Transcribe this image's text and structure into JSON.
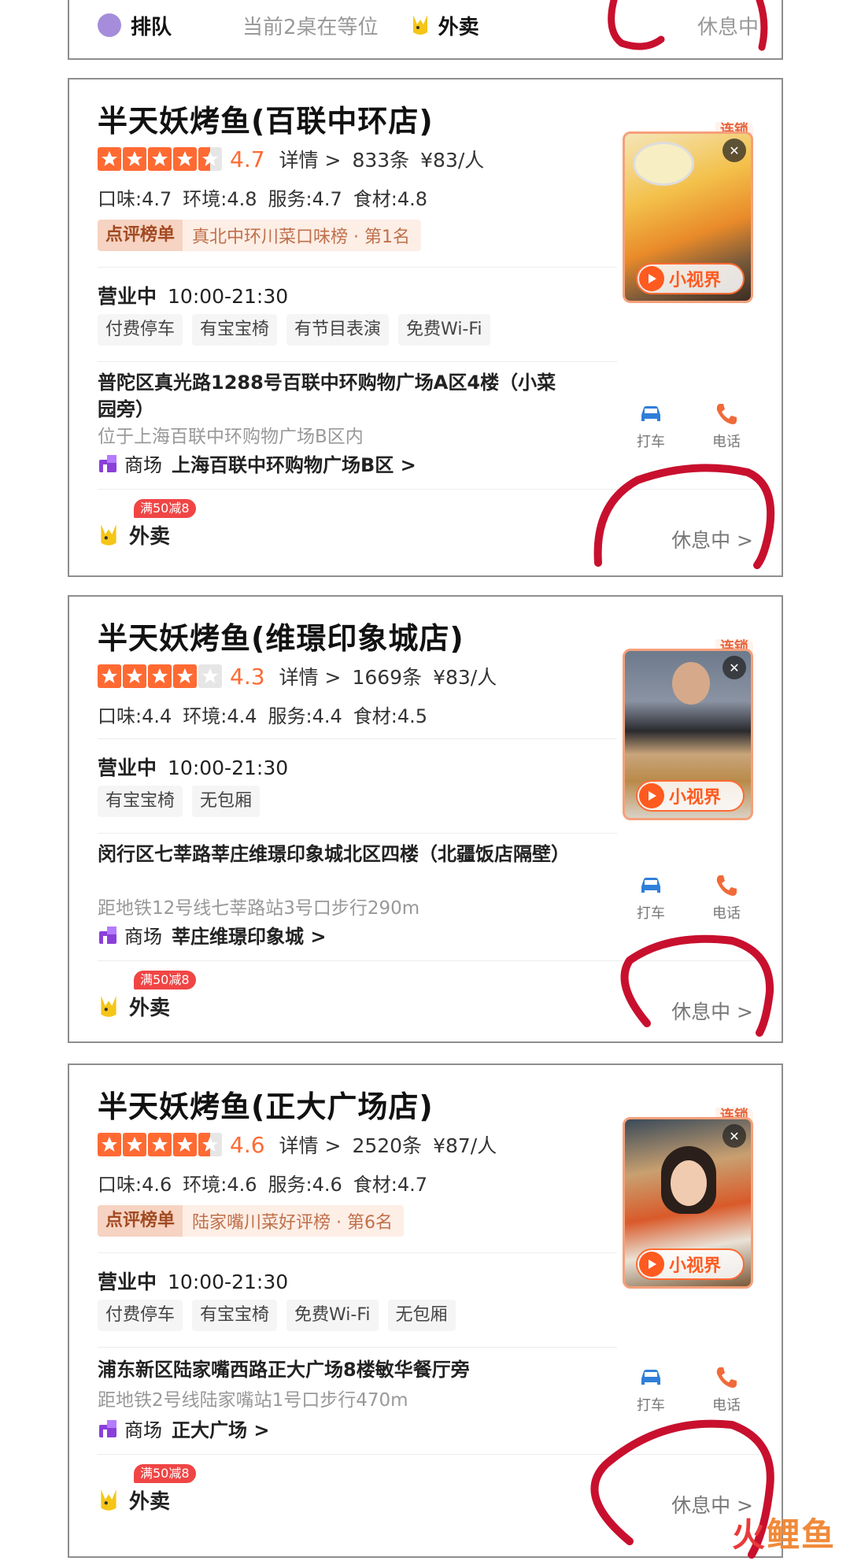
{
  "colors": {
    "accent": "#ff6a33",
    "star_empty": "#e6e6e6",
    "promo": "#f04545",
    "scribble": "#c8102e"
  },
  "top_card": {
    "queue_label": "排队",
    "queue_text": "当前2桌在等位",
    "takeout_label": "外卖",
    "status": "休息中"
  },
  "cards": [
    {
      "title": "半天妖烤鱼(百联中环店)",
      "rating": 4.7,
      "rating_text": "4.7",
      "detail_label": "详情 >",
      "reviews": "833条",
      "price": "¥83/人",
      "sub_scores": [
        "口味:4.7",
        "环境:4.8",
        "服务:4.7",
        "食材:4.8"
      ],
      "rank_badge": "点评榜单",
      "rank_text": "真北中环川菜口味榜 · 第1名",
      "hours_label": "营业中",
      "hours": "10:00-21:30",
      "tags": [
        "付费停车",
        "有宝宝椅",
        "有节目表演",
        "免费Wi-Fi"
      ],
      "address": "普陀区真光路1288号百联中环购物广场A区4楼（小菜园旁）",
      "nearby": "位于上海百联中环购物广场B区内",
      "mall_label": "商场",
      "mall_name": "上海百联中环购物广场B区 >",
      "takeout_label": "外卖",
      "promo": "满50减8",
      "status": "休息中 >",
      "ribbon": "连锁",
      "video_label": "小视界",
      "action_taxi": "打车",
      "action_phone": "电话"
    },
    {
      "title": "半天妖烤鱼(维璟印象城店)",
      "rating": 4.3,
      "rating_text": "4.3",
      "detail_label": "详情 >",
      "reviews": "1669条",
      "price": "¥83/人",
      "sub_scores": [
        "口味:4.4",
        "环境:4.4",
        "服务:4.4",
        "食材:4.5"
      ],
      "hours_label": "营业中",
      "hours": "10:00-21:30",
      "tags": [
        "有宝宝椅",
        "无包厢"
      ],
      "address": "闵行区七莘路莘庄维璟印象城北区四楼（北疆饭店隔壁）",
      "nearby": "距地铁12号线七莘路站3号口步行290m",
      "mall_label": "商场",
      "mall_name": "莘庄维璟印象城 >",
      "takeout_label": "外卖",
      "promo": "满50减8",
      "status": "休息中 >",
      "ribbon": "连锁",
      "video_label": "小视界",
      "action_taxi": "打车",
      "action_phone": "电话"
    },
    {
      "title": "半天妖烤鱼(正大广场店)",
      "rating": 4.6,
      "rating_text": "4.6",
      "detail_label": "详情 >",
      "reviews": "2520条",
      "price": "¥87/人",
      "sub_scores": [
        "口味:4.6",
        "环境:4.6",
        "服务:4.6",
        "食材:4.7"
      ],
      "rank_badge": "点评榜单",
      "rank_text": "陆家嘴川菜好评榜 · 第6名",
      "hours_label": "营业中",
      "hours": "10:00-21:30",
      "tags": [
        "付费停车",
        "有宝宝椅",
        "免费Wi-Fi",
        "无包厢"
      ],
      "address": "浦东新区陆家嘴西路正大广场8楼敏华餐厅旁",
      "nearby": "距地铁2号线陆家嘴站1号口步行470m",
      "mall_label": "商场",
      "mall_name": "正大广场 >",
      "takeout_label": "外卖",
      "promo": "满50减8",
      "status": "休息中 >",
      "ribbon": "连锁",
      "video_label": "小视界",
      "action_taxi": "打车",
      "action_phone": "电话"
    }
  ],
  "watermark": {
    "part1": "火",
    "part2": "鲤鱼"
  }
}
